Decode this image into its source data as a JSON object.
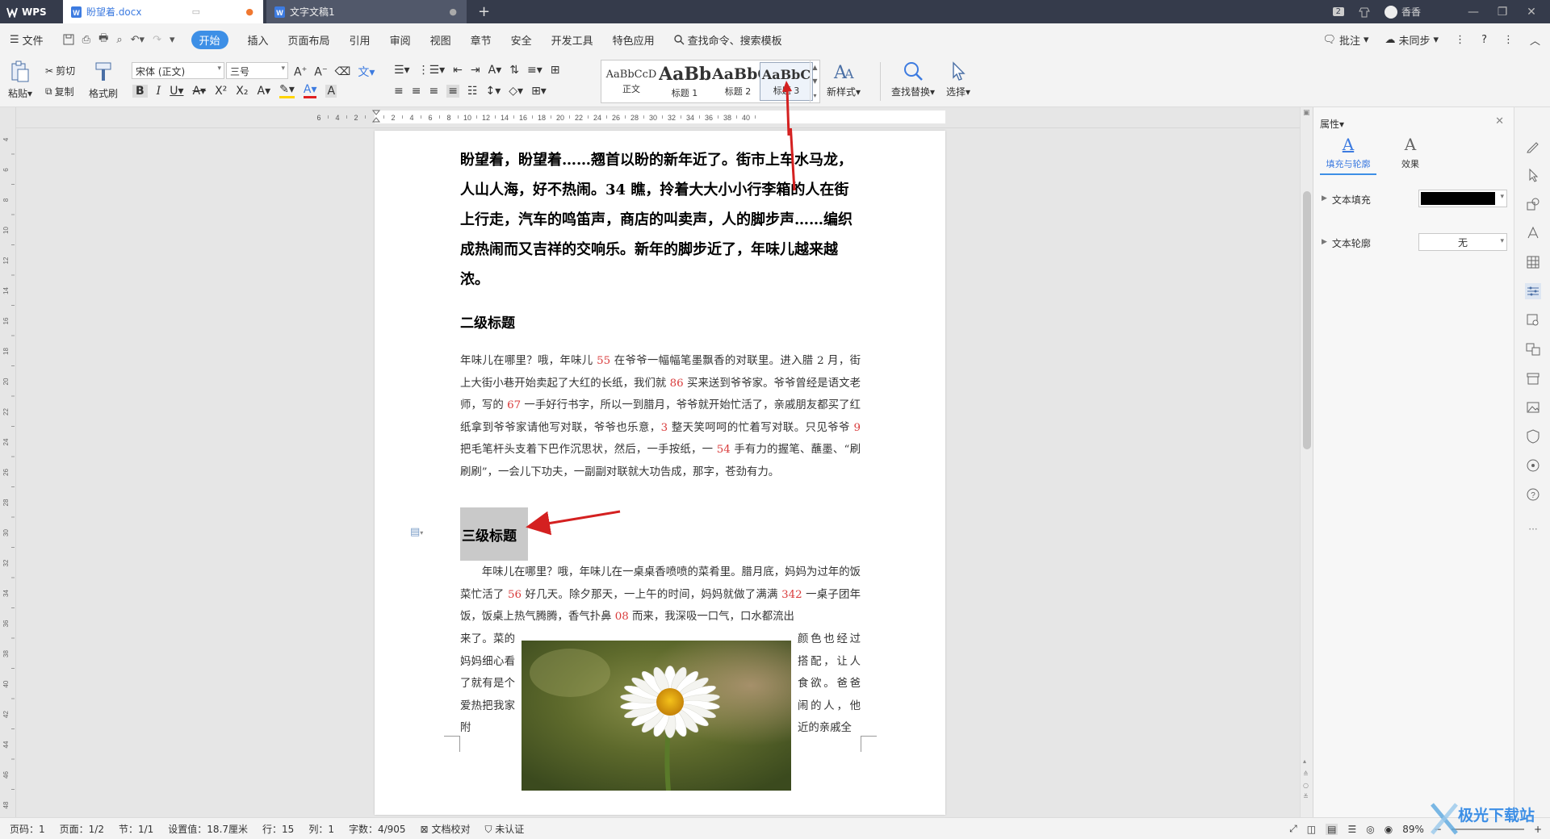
{
  "titlebar": {
    "app_name": "WPS",
    "tabs": [
      {
        "label": "盼望着.docx",
        "active": true
      },
      {
        "label": "文字文稿1",
        "active": false
      }
    ],
    "page_count_badge": "2",
    "user_name": "香香"
  },
  "menubar": {
    "file_label": "文件",
    "tabs": [
      "开始",
      "插入",
      "页面布局",
      "引用",
      "审阅",
      "视图",
      "章节",
      "安全",
      "开发工具",
      "特色应用"
    ],
    "active_tab": "开始",
    "search_label": "查找命令、搜索模板",
    "comment_label": "批注",
    "sync_label": "未同步",
    "help_label": "?"
  },
  "ribbon": {
    "paste_label": "粘贴",
    "cut_label": "剪切",
    "copy_label": "复制",
    "format_painter_label": "格式刷",
    "font_name": "宋体 (正文)",
    "font_size": "三号",
    "styles": [
      {
        "preview": "AaBbCcD",
        "name": "正文"
      },
      {
        "preview": "AaBb",
        "name": "标题 1"
      },
      {
        "preview": "AaBbC",
        "name": "标题 2"
      },
      {
        "preview": "AaBbC",
        "name": "标题 3"
      }
    ],
    "new_style_label": "新样式",
    "find_replace_label": "查找替换",
    "select_label": "选择"
  },
  "ruler": {
    "h_ticks": [
      "6",
      "4",
      "2",
      "",
      "2",
      "4",
      "6",
      "8",
      "10",
      "12",
      "14",
      "16",
      "18",
      "20",
      "22",
      "24",
      "26",
      "28",
      "30",
      "32",
      "34",
      "36",
      "38",
      "40"
    ],
    "v_ticks": [
      "4",
      "6",
      "8",
      "10",
      "12",
      "14",
      "16",
      "18",
      "20",
      "22",
      "24",
      "26",
      "28",
      "30",
      "32",
      "34",
      "36",
      "38",
      "40",
      "42",
      "44",
      "46",
      "48"
    ]
  },
  "document": {
    "bold_paragraph": "盼望着，盼望着……翘首以盼的新年近了。街市上车水马龙，人山人海，好不热闹。34 瞧，拎着大大小小行李箱的人在街上行走，汽车的鸣笛声，商店的叫卖声，人的脚步声……编织成热闹而又吉祥的交响乐。新年的脚步近了，年味儿越来越浓。",
    "heading2": "二级标题",
    "para1": [
      {
        "t": "年味儿在哪里？哦，年味儿 "
      },
      {
        "t": "55",
        "red": true
      },
      {
        "t": " 在爷爷一幅幅笔墨飘香的对联里。进入腊 2 月，街上大街小巷开始卖起了大红的长纸，我们就 "
      },
      {
        "t": "86",
        "red": true
      },
      {
        "t": " 买来送到爷爷家。爷爷曾经是语文老师，写的 "
      },
      {
        "t": "67",
        "red": true
      },
      {
        "t": " 一手好行书字，所以一到腊月，爷爷就开始忙活了，亲戚朋友都买了红纸拿到爷爷家请他写对联，爷爷也乐意，"
      },
      {
        "t": "3",
        "red": true
      },
      {
        "t": " 整天笑呵呵的忙着写对联。只见爷爷 "
      },
      {
        "t": "9",
        "red": true
      },
      {
        "t": " 把毛笔杆头支着下巴作沉思状，然后，一手按纸，一 "
      },
      {
        "t": "54",
        "red": true
      },
      {
        "t": " 手有力的握笔、蘸墨、“刷刷刷”，一会儿下功夫，一副副对联就大功告成，那字，苍劲有力。"
      }
    ],
    "heading3": "三级标题",
    "para2": [
      {
        "t": "　　年味儿在哪里？哦，年味儿在一桌桌香喷喷的菜肴里。腊月底，妈妈为过年的饭菜忙活了 "
      },
      {
        "t": "56",
        "red": true
      },
      {
        "t": " 好几天。除夕那天，一上午的时间，妈妈就做了满满 "
      },
      {
        "t": "342",
        "red": true
      },
      {
        "t": " 一桌子团年饭，饭桌上热气腾腾，香气扑鼻 "
      },
      {
        "t": "08",
        "red": true
      },
      {
        "t": " 而来，我深吸一口气，口水都流出"
      }
    ],
    "wrap_left": "来了。菜的妈妈细心看了就有是个爱热把我家附",
    "wrap_right": "颜色也经过搭配，让人食欲。爸爸闹的人，他近的亲戚全"
  },
  "properties_panel": {
    "title": "属性",
    "tabs": [
      "填充与轮廓",
      "效果"
    ],
    "text_fill_label": "文本填充",
    "text_fill_color": "#000000",
    "text_outline_label": "文本轮廓",
    "text_outline_value": "无"
  },
  "statusbar": {
    "items": [
      "页码：1",
      "页面：1/2",
      "节：1/1",
      "设置值：18.7厘米",
      "行：15",
      "列：1",
      "字数：4/905"
    ],
    "proofread_label": "文档校对",
    "cert_label": "未认证",
    "zoom": "89%"
  },
  "watermark": {
    "text": "极光下载站"
  },
  "colors": {
    "accent": "#3d8fe6",
    "titlebar": "#353b4b",
    "annotation_arrow": "#d42020",
    "number_red": "#d93b3b"
  }
}
